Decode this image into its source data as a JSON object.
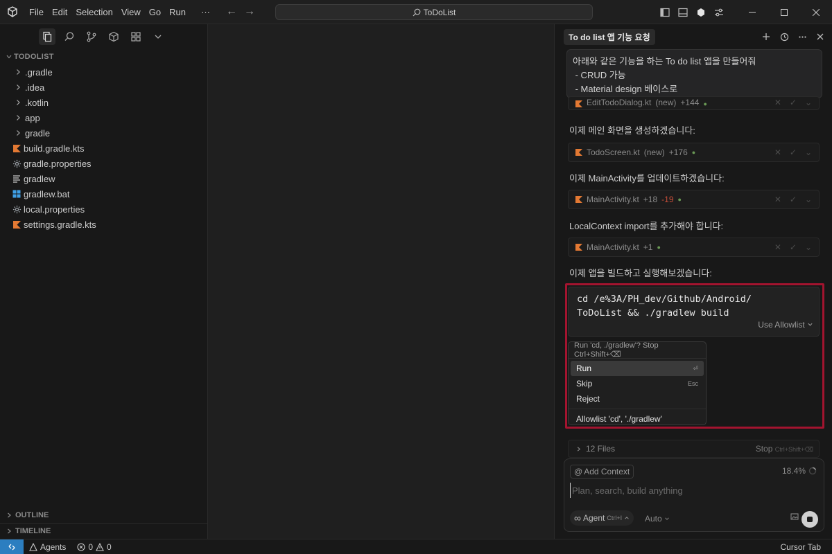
{
  "titlebar": {
    "menu": [
      "File",
      "Edit",
      "Selection",
      "View",
      "Go",
      "Run"
    ],
    "more": "···",
    "command_center": "ToDoList"
  },
  "sidebar": {
    "section_title": "TODOLIST",
    "items": [
      {
        "label": ".gradle",
        "kind": "folder"
      },
      {
        "label": ".idea",
        "kind": "folder"
      },
      {
        "label": ".kotlin",
        "kind": "folder"
      },
      {
        "label": "app",
        "kind": "folder"
      },
      {
        "label": "gradle",
        "kind": "folder"
      },
      {
        "label": "build.gradle.kts",
        "kind": "kotlin"
      },
      {
        "label": "gradle.properties",
        "kind": "gear"
      },
      {
        "label": "gradlew",
        "kind": "lines"
      },
      {
        "label": "gradlew.bat",
        "kind": "windows"
      },
      {
        "label": "local.properties",
        "kind": "gear"
      },
      {
        "label": "settings.gradle.kts",
        "kind": "kotlin"
      }
    ],
    "outline": "OUTLINE",
    "timeline": "TIMELINE"
  },
  "chat": {
    "tab_title": "To do list 앱 기능 요청",
    "user_message": {
      "line1": "아래와 같은 기능을 하는 To do list 앱을 만들어줘",
      "line2": " - CRUD 가능",
      "line3": " - Material design 베이스로"
    },
    "cards": [
      {
        "file": "EditTodoDialog.kt",
        "tag": "(new)",
        "add": "+144",
        "del": ""
      },
      {
        "file": "TodoScreen.kt",
        "tag": "(new)",
        "add": "+176",
        "del": ""
      },
      {
        "file": "MainActivity.kt",
        "tag": "",
        "add": "+18",
        "del": "-19"
      },
      {
        "file": "MainActivity.kt",
        "tag": "",
        "add": "+1",
        "del": ""
      }
    ],
    "steps": [
      "이제 메인 화면을 생성하겠습니다:",
      "이제 MainActivity를 업데이트하겠습니다:",
      "LocalContext import를 추가해야 합니다:",
      "이제 앱을 빌드하고 실행해보겠습니다:"
    ],
    "terminal": {
      "line1": "cd /e%3A/PH_dev/Github/Android/",
      "line2": "ToDoList && ./gradlew build",
      "allowlist_label": "Use Allowlist"
    },
    "run_menu": {
      "header": "Run 'cd, ./gradlew'? Stop Ctrl+Shift+⌫",
      "items": [
        {
          "label": "Run",
          "key": "⏎",
          "selected": true
        },
        {
          "label": "Skip",
          "key": "Esc",
          "selected": false
        },
        {
          "label": "Reject",
          "key": "",
          "selected": false
        }
      ],
      "allowlist_item": "Allowlist 'cd', './gradlew'"
    },
    "files_bar": {
      "label": "12 Files",
      "stop": "Stop",
      "stop_key": "Ctrl+Shift+⌫"
    },
    "composer": {
      "add_context": "Add Context",
      "context_pct": "18.4%",
      "placeholder": "Plan, search, build anything",
      "agent_label": "Agent",
      "agent_key": "Ctrl+I",
      "model": "Auto"
    }
  },
  "statusbar": {
    "agents": "Agents",
    "errors": "0",
    "warnings": "0",
    "cursor_tab": "Cursor Tab"
  },
  "colors": {
    "accent_blue": "#2c7ec0",
    "highlight_red": "#a3142f",
    "kotlin_orange": "#e37933",
    "diff_add": "#6a9955",
    "diff_del": "#c74e39"
  }
}
